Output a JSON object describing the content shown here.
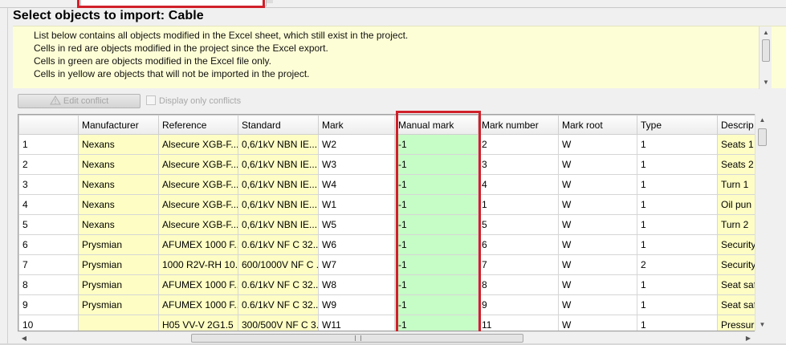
{
  "page_title": "Select objects to import: Cable",
  "info_lines": [
    "List below contains all objects modified in the Excel sheet, which still exist in the project.",
    "Cells in red are objects modified in the project since the Excel export.",
    "Cells in green are objects modified in the Excel file only.",
    "Cells in yellow are objects that will not be imported in the project."
  ],
  "toolbar": {
    "edit_conflict_label": "Edit conflict",
    "display_only_conflicts_label": "Display only conflicts"
  },
  "colors": {
    "yellow_cell": "#fefec4",
    "green_cell": "#c6fcc6",
    "highlight_red": "#d0202a",
    "info_background": "#fefed6"
  },
  "grid": {
    "columns": [
      "",
      "Manufacturer",
      "Reference",
      "Standard",
      "Mark",
      "Manual mark",
      "Mark number",
      "Mark root",
      "Type",
      "Descrip"
    ],
    "rows": [
      {
        "num": "1",
        "manufacturer": "Nexans",
        "reference": "Alsecure XGB-F...",
        "standard": "0,6/1kV NBN IE...",
        "mark": "W2",
        "manual_mark": "-1",
        "mark_number": "2",
        "mark_root": "W",
        "type": "1",
        "description": "Seats 1"
      },
      {
        "num": "2",
        "manufacturer": "Nexans",
        "reference": "Alsecure XGB-F...",
        "standard": "0,6/1kV NBN IE...",
        "mark": "W3",
        "manual_mark": "-1",
        "mark_number": "3",
        "mark_root": "W",
        "type": "1",
        "description": "Seats 2"
      },
      {
        "num": "3",
        "manufacturer": "Nexans",
        "reference": "Alsecure XGB-F...",
        "standard": "0,6/1kV NBN IE...",
        "mark": "W4",
        "manual_mark": "-1",
        "mark_number": "4",
        "mark_root": "W",
        "type": "1",
        "description": "Turn 1"
      },
      {
        "num": "4",
        "manufacturer": "Nexans",
        "reference": "Alsecure XGB-F...",
        "standard": "0,6/1kV NBN IE...",
        "mark": "W1",
        "manual_mark": "-1",
        "mark_number": "1",
        "mark_root": "W",
        "type": "1",
        "description": "Oil pun"
      },
      {
        "num": "5",
        "manufacturer": "Nexans",
        "reference": "Alsecure XGB-F...",
        "standard": "0,6/1kV NBN IE...",
        "mark": "W5",
        "manual_mark": "-1",
        "mark_number": "5",
        "mark_root": "W",
        "type": "1",
        "description": "Turn 2"
      },
      {
        "num": "6",
        "manufacturer": "Prysmian",
        "reference": "AFUMEX 1000 F...",
        "standard": "0.6/1kV NF C 32...",
        "mark": "W6",
        "manual_mark": "-1",
        "mark_number": "6",
        "mark_root": "W",
        "type": "1",
        "description": "Security"
      },
      {
        "num": "7",
        "manufacturer": "Prysmian",
        "reference": "1000 R2V-RH 10...",
        "standard": "600/1000V NF C ...",
        "mark": "W7",
        "manual_mark": "-1",
        "mark_number": "7",
        "mark_root": "W",
        "type": "2",
        "description": "Security"
      },
      {
        "num": "8",
        "manufacturer": "Prysmian",
        "reference": "AFUMEX 1000 F...",
        "standard": "0.6/1kV NF C 32...",
        "mark": "W8",
        "manual_mark": "-1",
        "mark_number": "8",
        "mark_root": "W",
        "type": "1",
        "description": "Seat saf"
      },
      {
        "num": "9",
        "manufacturer": "Prysmian",
        "reference": "AFUMEX 1000 F...",
        "standard": "0.6/1kV NF C 32...",
        "mark": "W9",
        "manual_mark": "-1",
        "mark_number": "9",
        "mark_root": "W",
        "type": "1",
        "description": "Seat saf"
      },
      {
        "num": "10",
        "manufacturer": "",
        "reference": "H05 VV-V 2G1.5",
        "standard": "300/500V NF C 3...",
        "mark": "W11",
        "manual_mark": "-1",
        "mark_number": "11",
        "mark_root": "W",
        "type": "1",
        "description": "Pressur"
      }
    ]
  }
}
